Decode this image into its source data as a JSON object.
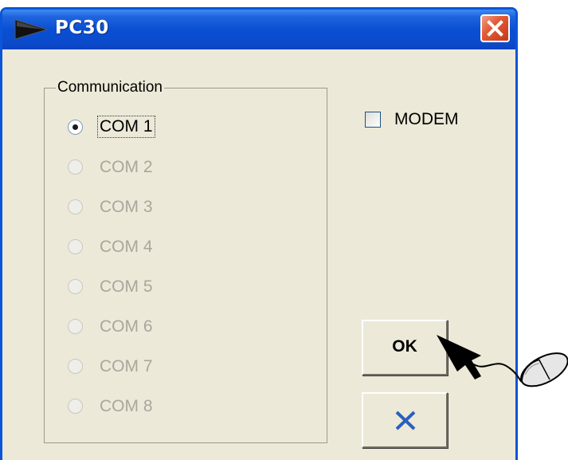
{
  "window": {
    "title": "PC30",
    "icon": "arrow-triangle-icon",
    "close_icon": "close-x-icon"
  },
  "communication": {
    "legend": "Communication",
    "options": [
      {
        "label": "COM 1",
        "selected": true,
        "enabled": true
      },
      {
        "label": "COM 2",
        "selected": false,
        "enabled": false
      },
      {
        "label": "COM 3",
        "selected": false,
        "enabled": false
      },
      {
        "label": "COM 4",
        "selected": false,
        "enabled": false
      },
      {
        "label": "COM 5",
        "selected": false,
        "enabled": false
      },
      {
        "label": "COM 6",
        "selected": false,
        "enabled": false
      },
      {
        "label": "COM 7",
        "selected": false,
        "enabled": false
      },
      {
        "label": "COM 8",
        "selected": false,
        "enabled": false
      }
    ]
  },
  "modem": {
    "label": "MODEM",
    "checked": false
  },
  "buttons": {
    "ok_label": "OK",
    "cancel_icon": "blue-x-icon"
  },
  "annotation": {
    "pointer": "black-arrow-pointer-icon",
    "mouse": "computer-mouse-icon"
  },
  "colors": {
    "titlebar": "#0a4fd3",
    "dialog_bg": "#ece9d8",
    "close_button": "#e35b36",
    "cancel_x": "#2a5fc0",
    "disabled_text": "#a9a79c"
  }
}
